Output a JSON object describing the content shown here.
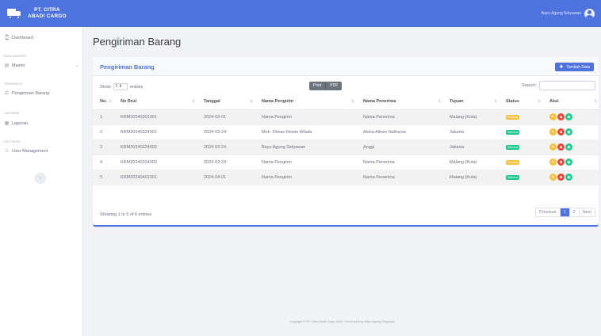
{
  "brand": {
    "line1": "PT. CITRA",
    "line2": "ABADI CARGO"
  },
  "user": {
    "name": "Bayu Agung Setyawan"
  },
  "sidebar": {
    "dashboard": "Dashboard",
    "head_master": "DATA MASTER",
    "master": "Master",
    "head_transaksi": "TRANSAKSI",
    "pengiriman": "Pengiriman Barang",
    "head_laporan": "LAPORAN",
    "laporan": "Laporan",
    "head_settings": "SETTINGS",
    "user_mgmt": "User Management",
    "toggle": "‹"
  },
  "page": {
    "title": "Pengiriman Barang",
    "card_title": "Pengiriman Barang",
    "add_button": "Tambah Data",
    "show_label": "Show",
    "show_value": "5",
    "entries_label": "entries",
    "print": "Print",
    "pdf": "PDF",
    "search_label": "Search:"
  },
  "table": {
    "columns": [
      "No.",
      "No Resi",
      "Tanggal",
      "Nama Pengirim",
      "Nama Penerima",
      "Tujuan",
      "Status",
      "Aksi"
    ],
    "rows": [
      {
        "no": "1",
        "resi": "KRM20240301001",
        "tanggal": "2024-03-01",
        "pengirim": "Nama Pengirim",
        "penerima": "Nama Penerima",
        "tujuan": "Malang (Kota)",
        "status": "Pending"
      },
      {
        "no": "2",
        "resi": "KRM20240324001",
        "tanggal": "2024-03-24",
        "pengirim": "Moh. Dimas Rewin Whafa",
        "penerima": "Aisha Aileen Nathania",
        "tujuan": "Jakarta",
        "status": "Diterima"
      },
      {
        "no": "3",
        "resi": "KRM20240324002",
        "tanggal": "2024-03-24",
        "pengirim": "Bayu Agung Setyawan",
        "penerima": "Anggi",
        "tujuan": "Jakarta",
        "status": "Diterima"
      },
      {
        "no": "4",
        "resi": "KRM20240324003",
        "tanggal": "2024-03-24",
        "pengirim": "Nama Pengirim",
        "penerima": "Nama Penerima",
        "tujuan": "Malang (Kota)",
        "status": "Pending"
      },
      {
        "no": "5",
        "resi": "KRM20240401001",
        "tanggal": "2024-04-01",
        "pengirim": "Nama Pengirim",
        "penerima": "Nama Penerima",
        "tujuan": "Malang (Kota)",
        "status": "Diterima"
      }
    ]
  },
  "pagination": {
    "info": "Showing 1 to 5 of 6 entries",
    "prev": "Previous",
    "p1": "1",
    "p2": "2",
    "next": "Next"
  },
  "footer": {
    "text": "Copyright © PT. Citra Abadi Cargo 2024 • Developed by Bayu Agung Setyawan"
  },
  "colors": {
    "primary": "#4e73df",
    "pending": "#f6c23e",
    "diterima": "#1cc88a",
    "edit": "#f6c23e",
    "delete": "#e74a3b",
    "view": "#1cc88a"
  }
}
